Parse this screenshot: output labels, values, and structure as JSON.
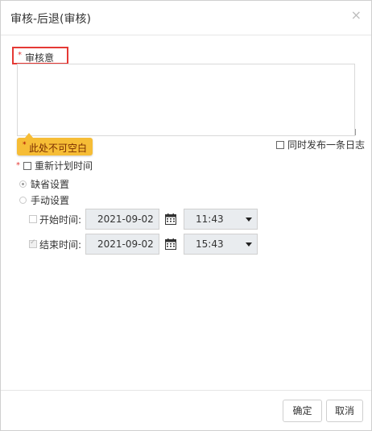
{
  "dialog": {
    "title": "审核-后退(审核)",
    "close_symbol": "×"
  },
  "form": {
    "opinion_required_mark": "*",
    "opinion_label": "审核意见:",
    "opinion_value": "",
    "validation_mark": "*",
    "validation_message": "此处不可空白",
    "publish_log_label": "同时发布一条日志",
    "publish_log_checked": false,
    "replan_required_mark": "*",
    "replan_label": "重新计划时间",
    "replan_checked": false,
    "mode_default_label": "缺省设置",
    "mode_default_selected": true,
    "mode_manual_label": "手动设置",
    "mode_manual_selected": false,
    "start_label": "开始时间:",
    "start_date": "2021-09-02",
    "start_time": "11:43",
    "end_label": "结束时间:",
    "end_date": "2021-09-02",
    "end_time": "15:43"
  },
  "footer": {
    "ok_label": "确定",
    "cancel_label": "取消"
  },
  "icons": {
    "close": "close-icon",
    "calendar": "calendar-icon",
    "dropdown": "chevron-down-icon"
  },
  "colors": {
    "required": "#e53935",
    "tooltip_bg": "#f6bd36",
    "disabled_field": "#e9ecef"
  }
}
